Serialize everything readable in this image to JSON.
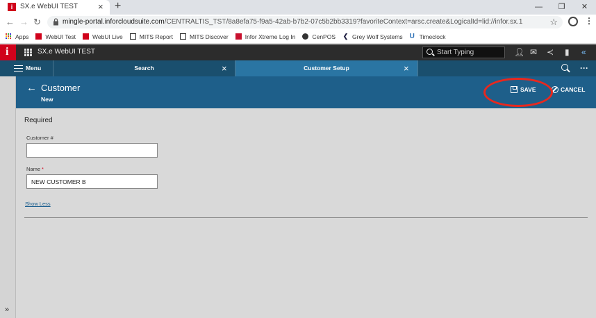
{
  "browser": {
    "tab_title": "SX.e WebUI TEST",
    "url_host": "mingle-portal.inforcloudsuite.com",
    "url_path": "/CENTRALTIS_TST/8a8efa75-f9a5-42ab-b7b2-07c5b2bb3319?favoriteContext=arsc.create&LogicalId=lid://infor.sx.1",
    "bookmarks": [
      {
        "label": "Apps",
        "icon": "apps-icon"
      },
      {
        "label": "WebUI Test",
        "icon": "infor-icon"
      },
      {
        "label": "WebUI Live",
        "icon": "infor-icon"
      },
      {
        "label": "MITS Report",
        "icon": "mits-icon"
      },
      {
        "label": "MITS Discover",
        "icon": "mits-icon"
      },
      {
        "label": "Infor Xtreme Log In",
        "icon": "xtreme-icon"
      },
      {
        "label": "CenPOS",
        "icon": "cenpos-icon"
      },
      {
        "label": "Grey Wolf Systems",
        "icon": "greywolf-icon"
      },
      {
        "label": "Timeclock",
        "icon": "timeclock-icon"
      }
    ]
  },
  "app": {
    "logo_letter": "i",
    "title": "SX.e WebUI TEST",
    "search_placeholder": "Start Typing"
  },
  "workspace": {
    "menu_label": "Menu",
    "tabs": [
      {
        "label": "Search",
        "active": false
      },
      {
        "label": "Customer Setup",
        "active": true
      }
    ]
  },
  "page": {
    "title": "Customer",
    "subtitle": "New",
    "save_label": "SAVE",
    "cancel_label": "CANCEL"
  },
  "form": {
    "section_title": "Required",
    "customer_number_label": "Customer #",
    "customer_number_value": "",
    "name_label": "Name",
    "name_value": "NEW CUSTOMER B",
    "show_less_label": "Show Less"
  },
  "colors": {
    "accent": "#1e5f8a",
    "tab_active": "#2a75a3",
    "highlight": "#e8281e"
  }
}
